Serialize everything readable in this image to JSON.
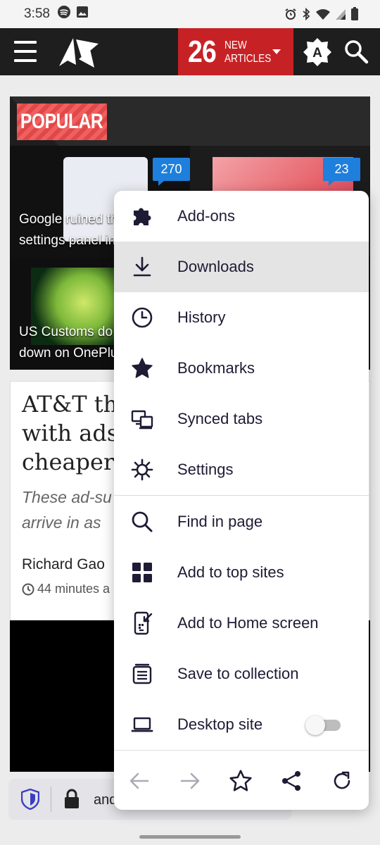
{
  "status_bar": {
    "time": "3:58",
    "icons": [
      "spotify-icon",
      "gallery-icon",
      "alarm-icon",
      "bluetooth-icon",
      "wifi-icon",
      "signal-icon",
      "battery-icon"
    ]
  },
  "header": {
    "new_count": "26",
    "new_label_line1": "NEW",
    "new_label_line2": "ARTICLES",
    "theme_button_letter": "A",
    "brand_color": "#c62226"
  },
  "popular": {
    "badge": "POPULAR",
    "cards": [
      {
        "title_line1": "Google ruined th",
        "title_line2": "settings panel in",
        "comments": "270"
      },
      {
        "title_line1": "",
        "title_line2": "",
        "comments": "23"
      },
      {
        "title_line1": "US Customs do",
        "title_line2": "down on OnePlu",
        "comments": ""
      },
      {
        "title_line1": "",
        "title_line2": "",
        "comments": ""
      }
    ]
  },
  "article": {
    "title": "AT&T thi\nwith ads\ncheaper ",
    "subtitle": "These ad-su\narrive in as ",
    "author": "Richard Gao",
    "time": "44 minutes a"
  },
  "url_bar": {
    "url_fragment": "and"
  },
  "menu": {
    "items": [
      {
        "label": "Add-ons",
        "icon": "puzzle-icon"
      },
      {
        "label": "Downloads",
        "icon": "download-icon"
      },
      {
        "label": "History",
        "icon": "clock-icon"
      },
      {
        "label": "Bookmarks",
        "icon": "star-filled-icon"
      },
      {
        "label": "Synced tabs",
        "icon": "synced-devices-icon"
      },
      {
        "label": "Settings",
        "icon": "gear-icon"
      },
      {
        "label": "Find in page",
        "icon": "search-icon"
      },
      {
        "label": "Add to top sites",
        "icon": "grid-icon"
      },
      {
        "label": "Add to Home screen",
        "icon": "phone-add-icon"
      },
      {
        "label": "Save to collection",
        "icon": "collection-icon"
      },
      {
        "label": "Desktop site",
        "icon": "laptop-icon"
      }
    ],
    "highlighted": "Downloads",
    "desktop_site_enabled": false,
    "nav_buttons": [
      "back-icon",
      "forward-icon",
      "bookmark-star-icon",
      "share-icon",
      "reload-icon"
    ]
  }
}
